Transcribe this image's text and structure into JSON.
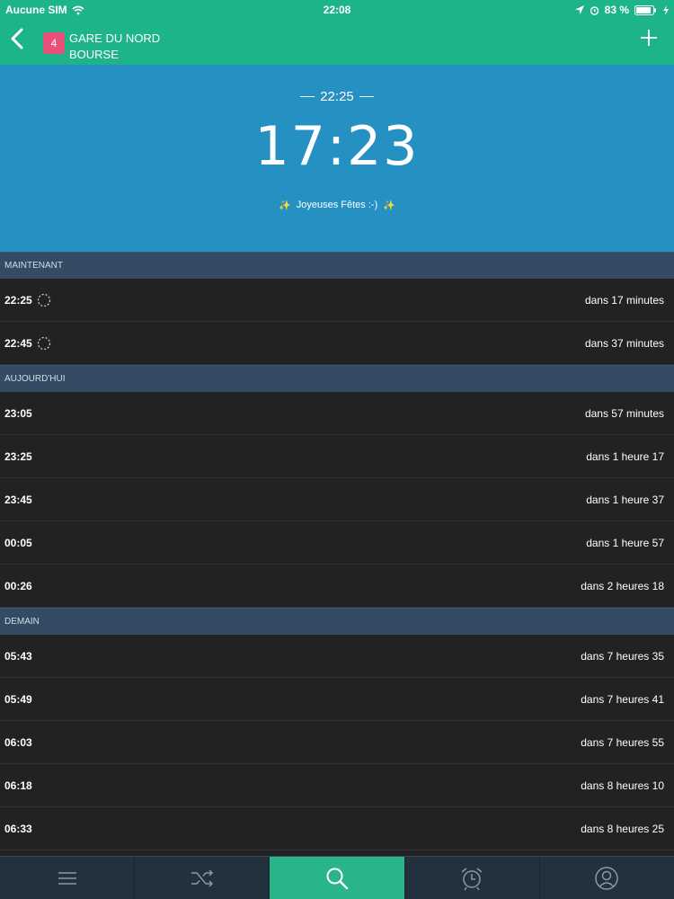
{
  "status_bar": {
    "carrier": "Aucune SIM",
    "time": "22:08",
    "battery": "83 %"
  },
  "header": {
    "line_number": "4",
    "line_color": "#e8507b",
    "from_stop": "GARE DU NORD",
    "to_stop": "BOURSE"
  },
  "hero": {
    "next_departure": "22:25",
    "countdown": "17:23",
    "greeting": "Joyeuses Fêtes :-)"
  },
  "sections": [
    {
      "title": "MAINTENANT",
      "rows": [
        {
          "time": "22:25",
          "eta": "dans 17 minutes",
          "realtime": true
        },
        {
          "time": "22:45",
          "eta": "dans 37 minutes",
          "realtime": true
        }
      ]
    },
    {
      "title": "AUJOURD'HUI",
      "rows": [
        {
          "time": "23:05",
          "eta": "dans 57 minutes",
          "realtime": false
        },
        {
          "time": "23:25",
          "eta": "dans 1 heure 17",
          "realtime": false
        },
        {
          "time": "23:45",
          "eta": "dans 1 heure 37",
          "realtime": false
        },
        {
          "time": "00:05",
          "eta": "dans 1 heure 57",
          "realtime": false
        },
        {
          "time": "00:26",
          "eta": "dans 2 heures 18",
          "realtime": false
        }
      ]
    },
    {
      "title": "DEMAIN",
      "rows": [
        {
          "time": "05:43",
          "eta": "dans 7 heures 35",
          "realtime": false
        },
        {
          "time": "05:49",
          "eta": "dans 7 heures 41",
          "realtime": false
        },
        {
          "time": "06:03",
          "eta": "dans 7 heures 55",
          "realtime": false
        },
        {
          "time": "06:18",
          "eta": "dans 8 heures 10",
          "realtime": false
        },
        {
          "time": "06:33",
          "eta": "dans 8 heures 25",
          "realtime": false
        }
      ]
    }
  ],
  "tab_bar": {
    "active_tab": "search",
    "tabs": [
      {
        "id": "menu",
        "icon": "menu-icon"
      },
      {
        "id": "shuffle",
        "icon": "shuffle-icon"
      },
      {
        "id": "search",
        "icon": "search-icon"
      },
      {
        "id": "alarm",
        "icon": "alarm-clock-icon"
      },
      {
        "id": "profile",
        "icon": "user-icon"
      }
    ]
  },
  "colors": {
    "accent": "#1eb48a",
    "hero": "#2591c2",
    "section": "#344b63",
    "list_bg": "#222224",
    "tab_bg": "#23303e"
  }
}
